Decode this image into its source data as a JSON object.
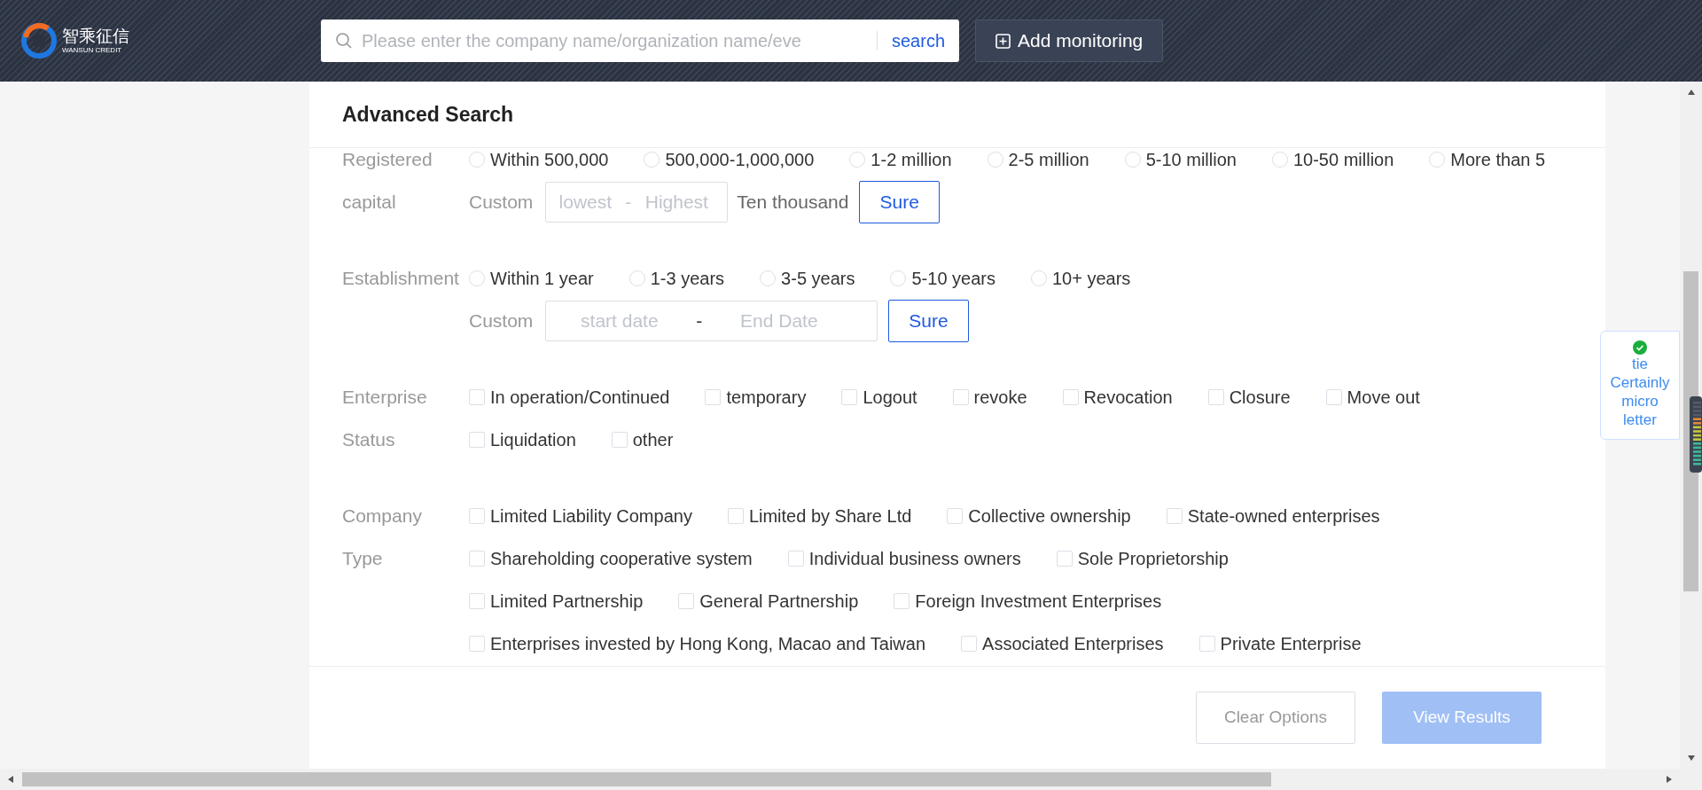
{
  "header": {
    "logo": {
      "name": "智乘征信",
      "tagline": "WANSUN CREDIT"
    },
    "search": {
      "placeholder": "Please enter the company name/organization name/eve",
      "button": "search"
    },
    "add_button": "Add monitoring"
  },
  "panel": {
    "title": "Advanced Search",
    "groups": [
      {
        "label": [
          "Registered",
          "capital"
        ],
        "kind": "radio",
        "lines": [
          {
            "options": [
              {
                "label": "Within 500,000",
                "selected": false
              },
              {
                "label": "500,000-1,000,000",
                "selected": false
              },
              {
                "label": "1-2 million",
                "selected": false
              },
              {
                "label": "2-5 million",
                "selected": false
              },
              {
                "label": "5-10 million",
                "selected": false
              },
              {
                "label": "10-50 million",
                "selected": false
              },
              {
                "label": "More than 5",
                "selected": false
              }
            ]
          }
        ],
        "custom": {
          "label": "Custom",
          "kind": "range",
          "from_placeholder": "lowest",
          "separator": "-",
          "to_placeholder": "Highest",
          "unit": "Ten thousand",
          "button": "Sure"
        }
      },
      {
        "label": [
          "Establishment"
        ],
        "kind": "radio",
        "lines": [
          {
            "options": [
              {
                "label": "Within 1 year",
                "selected": false
              },
              {
                "label": "1-3 years",
                "selected": false
              },
              {
                "label": "3-5 years",
                "selected": false
              },
              {
                "label": "5-10 years",
                "selected": false
              },
              {
                "label": "10+ years",
                "selected": false
              }
            ]
          }
        ],
        "custom": {
          "label": "Custom",
          "kind": "date",
          "from_placeholder": "start date",
          "separator": "-",
          "to_placeholder": "End Date",
          "button": "Sure"
        }
      },
      {
        "label": [
          "Enterprise",
          "Status"
        ],
        "kind": "checkbox",
        "lines": [
          {
            "options": [
              {
                "label": "In operation/Continued",
                "checked": false
              },
              {
                "label": "temporary",
                "checked": false
              },
              {
                "label": "Logout",
                "checked": false
              },
              {
                "label": "revoke",
                "checked": false
              },
              {
                "label": "Revocation",
                "checked": false
              },
              {
                "label": "Closure",
                "checked": false
              },
              {
                "label": "Move out",
                "checked": false
              }
            ]
          },
          {
            "options": [
              {
                "label": "Liquidation",
                "checked": false
              },
              {
                "label": "other",
                "checked": false
              }
            ]
          }
        ]
      },
      {
        "label": [
          "Company",
          "Type"
        ],
        "kind": "checkbox",
        "lines": [
          {
            "options": [
              {
                "label": "Limited Liability Company",
                "checked": false
              },
              {
                "label": "Limited by Share Ltd",
                "checked": false
              },
              {
                "label": "Collective ownership",
                "checked": false
              },
              {
                "label": "State-owned enterprises",
                "checked": false
              }
            ]
          },
          {
            "options": [
              {
                "label": "Shareholding cooperative system",
                "checked": false
              },
              {
                "label": "Individual business owners",
                "checked": false
              },
              {
                "label": "Sole Proprietorship",
                "checked": false
              }
            ]
          },
          {
            "options": [
              {
                "label": "Limited Partnership",
                "checked": false
              },
              {
                "label": "General Partnership",
                "checked": false
              },
              {
                "label": "Foreign Investment Enterprises",
                "checked": false
              }
            ]
          },
          {
            "options": [
              {
                "label": "Enterprises invested by Hong Kong, Macao and Taiwan",
                "checked": false
              },
              {
                "label": "Associated Enterprises",
                "checked": false
              },
              {
                "label": "Private Enterprise",
                "checked": false
              }
            ]
          }
        ]
      }
    ],
    "buttons": [
      {
        "label": "Clear Options",
        "kind": "secondary",
        "disabled": false
      },
      {
        "label": "View Results",
        "kind": "primary",
        "disabled": true
      }
    ]
  },
  "side_widget": {
    "label": "tie Certainly micro letter"
  }
}
